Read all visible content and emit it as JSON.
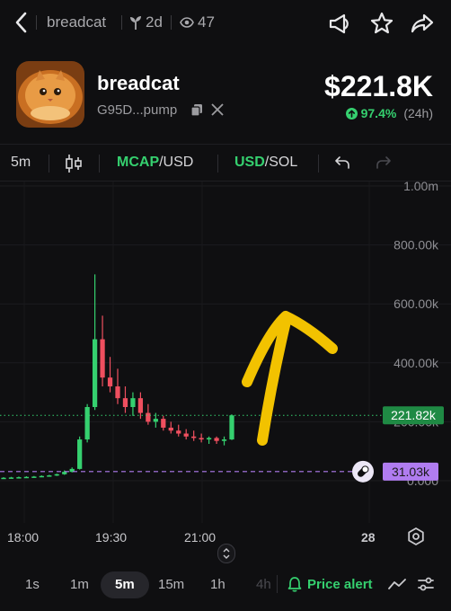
{
  "nav": {
    "token_name": "breadcat",
    "age": "2d",
    "views": "47",
    "icons": [
      "back-chevron-icon",
      "megaphone-icon",
      "star-icon",
      "share-icon"
    ]
  },
  "token": {
    "name": "breadcat",
    "address_short": "G95D...pump",
    "price": "$221.8K",
    "change_pct": "97.4%",
    "change_period": "(24h)",
    "change_color": "#35d06f"
  },
  "toolbar": {
    "interval": "5m",
    "mcap_label": "MCAP",
    "usd_label_1": "/USD",
    "usd_label_2": "USD",
    "sol_label": "/SOL",
    "accent_color": "#35d06f"
  },
  "chart_data": {
    "type": "candlestick",
    "y_ticks": [
      "1.00m",
      "800.00k",
      "600.00k",
      "400.00k",
      "200.00k",
      "0.000"
    ],
    "ylim": [
      0,
      1000000
    ],
    "x_ticks": [
      "18:00",
      "19:30",
      "21:00",
      "28"
    ],
    "current_price_label": "221.82k",
    "current_price_value": 221820,
    "reference_line_label": "31.03k",
    "reference_line_value": 31030,
    "up_color": "#35d06f",
    "down_color": "#ef4f5f",
    "candles": [
      {
        "o": 8000,
        "h": 12000,
        "l": 6000,
        "c": 10000
      },
      {
        "o": 10000,
        "h": 13000,
        "l": 9000,
        "c": 11000
      },
      {
        "o": 11000,
        "h": 14000,
        "l": 9500,
        "c": 12000
      },
      {
        "o": 12000,
        "h": 15000,
        "l": 10000,
        "c": 13000
      },
      {
        "o": 13000,
        "h": 16000,
        "l": 11000,
        "c": 14000
      },
      {
        "o": 14000,
        "h": 18000,
        "l": 12000,
        "c": 16000
      },
      {
        "o": 16000,
        "h": 20000,
        "l": 14000,
        "c": 18000
      },
      {
        "o": 18000,
        "h": 24000,
        "l": 16000,
        "c": 22000
      },
      {
        "o": 22000,
        "h": 35000,
        "l": 20000,
        "c": 30000
      },
      {
        "o": 30000,
        "h": 45000,
        "l": 28000,
        "c": 40000
      },
      {
        "o": 40000,
        "h": 150000,
        "l": 38000,
        "c": 140000
      },
      {
        "o": 140000,
        "h": 260000,
        "l": 130000,
        "c": 250000
      },
      {
        "o": 250000,
        "h": 700000,
        "l": 240000,
        "c": 480000
      },
      {
        "o": 480000,
        "h": 560000,
        "l": 320000,
        "c": 350000
      },
      {
        "o": 350000,
        "h": 420000,
        "l": 300000,
        "c": 320000
      },
      {
        "o": 320000,
        "h": 380000,
        "l": 260000,
        "c": 280000
      },
      {
        "o": 280000,
        "h": 320000,
        "l": 230000,
        "c": 250000
      },
      {
        "o": 250000,
        "h": 300000,
        "l": 220000,
        "c": 280000
      },
      {
        "o": 280000,
        "h": 300000,
        "l": 210000,
        "c": 230000
      },
      {
        "o": 230000,
        "h": 260000,
        "l": 190000,
        "c": 200000
      },
      {
        "o": 200000,
        "h": 230000,
        "l": 180000,
        "c": 210000
      },
      {
        "o": 210000,
        "h": 220000,
        "l": 170000,
        "c": 180000
      },
      {
        "o": 180000,
        "h": 200000,
        "l": 160000,
        "c": 170000
      },
      {
        "o": 170000,
        "h": 190000,
        "l": 150000,
        "c": 160000
      },
      {
        "o": 160000,
        "h": 175000,
        "l": 140000,
        "c": 150000
      },
      {
        "o": 150000,
        "h": 170000,
        "l": 135000,
        "c": 145000
      },
      {
        "o": 145000,
        "h": 160000,
        "l": 130000,
        "c": 140000
      },
      {
        "o": 140000,
        "h": 150000,
        "l": 125000,
        "c": 145000
      },
      {
        "o": 145000,
        "h": 150000,
        "l": 125000,
        "c": 135000
      },
      {
        "o": 135000,
        "h": 150000,
        "l": 120000,
        "c": 140000
      },
      {
        "o": 140000,
        "h": 225000,
        "l": 138000,
        "c": 221820
      }
    ]
  },
  "time_axis": {
    "label_1": "18:00",
    "label_2": "19:30",
    "label_3": "21:00",
    "label_4": "28"
  },
  "timeframes": {
    "options": [
      "1s",
      "1m",
      "5m",
      "15m",
      "1h",
      "4h"
    ],
    "selected": "5m",
    "price_alert_label": "Price alert"
  },
  "annotation_color": "#f2c200"
}
